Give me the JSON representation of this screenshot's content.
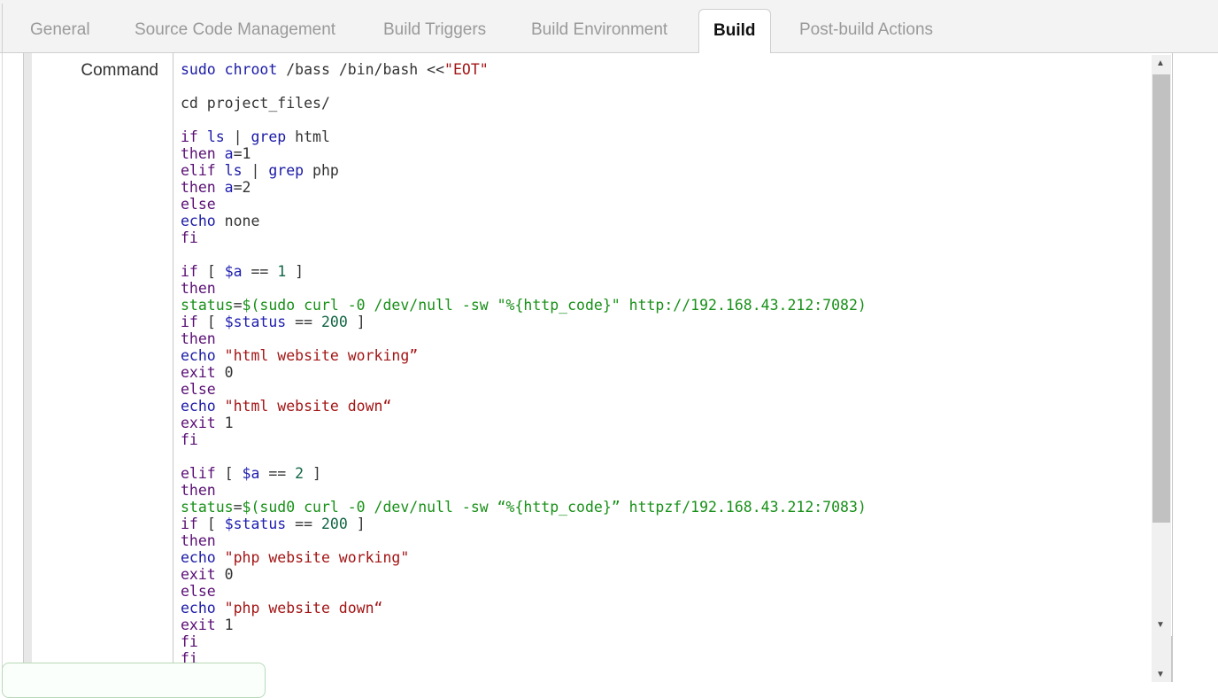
{
  "tabs": [
    {
      "label": "General"
    },
    {
      "label": "Source Code Management"
    },
    {
      "label": "Build Triggers"
    },
    {
      "label": "Build Environment"
    },
    {
      "label": "Build"
    },
    {
      "label": "Post-build Actions"
    }
  ],
  "active_tab": "Build",
  "command": {
    "label": "Command",
    "lines": [
      [
        [
          "cmd",
          "sudo "
        ],
        [
          "cmd",
          "chroot "
        ],
        [
          "plain",
          "/bass /bin/bash <<"
        ],
        [
          "str",
          "\"EOT\""
        ]
      ],
      [],
      [
        [
          "plain",
          "cd project_files/"
        ]
      ],
      [],
      [
        [
          "kw",
          "if "
        ],
        [
          "cmd",
          "ls "
        ],
        [
          "plain",
          "| "
        ],
        [
          "cmd",
          "grep "
        ],
        [
          "plain",
          "html"
        ]
      ],
      [
        [
          "kw",
          "then "
        ],
        [
          "var",
          "a"
        ],
        [
          "plain",
          "=1"
        ]
      ],
      [
        [
          "kw",
          "elif "
        ],
        [
          "cmd",
          "ls "
        ],
        [
          "plain",
          "| "
        ],
        [
          "cmd",
          "grep "
        ],
        [
          "plain",
          "php"
        ]
      ],
      [
        [
          "kw",
          "then "
        ],
        [
          "var",
          "a"
        ],
        [
          "plain",
          "=2"
        ]
      ],
      [
        [
          "kw",
          "else"
        ]
      ],
      [
        [
          "cmd",
          "echo "
        ],
        [
          "plain",
          "none"
        ]
      ],
      [
        [
          "kw",
          "fi"
        ]
      ],
      [],
      [
        [
          "kw",
          "if "
        ],
        [
          "plain",
          "[ "
        ],
        [
          "var",
          "$a"
        ],
        [
          "plain",
          " == "
        ],
        [
          "num",
          "1"
        ],
        [
          "plain",
          " ]"
        ]
      ],
      [
        [
          "kw",
          "then"
        ]
      ],
      [
        [
          "grn",
          "status"
        ],
        [
          "plain",
          "="
        ],
        [
          "grn",
          "$(sudo curl -0 /dev/null -sw \"%{http_code}\" http://192.168.43.212:7082)"
        ]
      ],
      [
        [
          "kw",
          "if "
        ],
        [
          "plain",
          "[ "
        ],
        [
          "var",
          "$status"
        ],
        [
          "plain",
          " == "
        ],
        [
          "num",
          "200"
        ],
        [
          "plain",
          " ]"
        ]
      ],
      [
        [
          "kw",
          "then"
        ]
      ],
      [
        [
          "cmd",
          "echo "
        ],
        [
          "str",
          "\"html website working”"
        ]
      ],
      [
        [
          "kw",
          "exit "
        ],
        [
          "plain",
          "0"
        ]
      ],
      [
        [
          "kw",
          "else"
        ]
      ],
      [
        [
          "cmd",
          "echo "
        ],
        [
          "str",
          "\"html website down“"
        ]
      ],
      [
        [
          "kw",
          "exit "
        ],
        [
          "plain",
          "1"
        ]
      ],
      [
        [
          "kw",
          "fi"
        ]
      ],
      [],
      [
        [
          "kw",
          "elif "
        ],
        [
          "plain",
          "[ "
        ],
        [
          "var",
          "$a"
        ],
        [
          "plain",
          " == "
        ],
        [
          "num",
          "2"
        ],
        [
          "plain",
          " ]"
        ]
      ],
      [
        [
          "kw",
          "then"
        ]
      ],
      [
        [
          "grn",
          "status"
        ],
        [
          "plain",
          "="
        ],
        [
          "grn",
          "$(sud0 curl -0 /dev/null -sw “%{http_code}” httpzf/192.168.43.212:7083)"
        ]
      ],
      [
        [
          "kw",
          "if "
        ],
        [
          "plain",
          "[ "
        ],
        [
          "var",
          "$status"
        ],
        [
          "plain",
          " == "
        ],
        [
          "num",
          "200"
        ],
        [
          "plain",
          " ]"
        ]
      ],
      [
        [
          "kw",
          "then"
        ]
      ],
      [
        [
          "cmd",
          "echo "
        ],
        [
          "str",
          "\"php website working\""
        ]
      ],
      [
        [
          "kw",
          "exit "
        ],
        [
          "plain",
          "0"
        ]
      ],
      [
        [
          "kw",
          "else"
        ]
      ],
      [
        [
          "cmd",
          "echo "
        ],
        [
          "str",
          "\"php website down“"
        ]
      ],
      [
        [
          "kw",
          "exit "
        ],
        [
          "plain",
          "1"
        ]
      ],
      [
        [
          "kw",
          "fi"
        ]
      ],
      [
        [
          "kw",
          "fi"
        ]
      ]
    ]
  },
  "colors": {
    "keyword": "#5a0e74",
    "command": "#1a1aa6",
    "string": "#a31515",
    "variable": "#1f1fb0",
    "number": "#116644",
    "green": "#189018"
  },
  "icons": {
    "scroll_up": "▲",
    "scroll_down": "▼"
  }
}
